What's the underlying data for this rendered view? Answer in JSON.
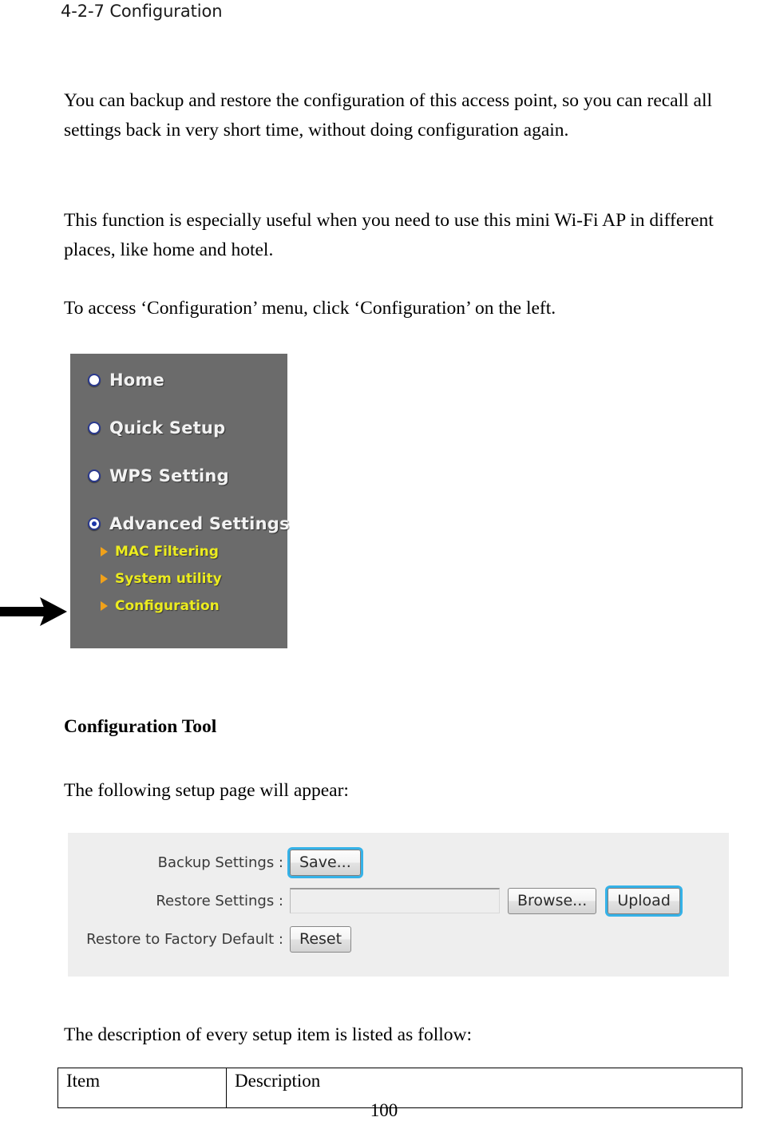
{
  "document": {
    "heading": "4-2-7 Configuration",
    "paragraph_1": "You can backup and restore the configuration of this access point, so you can recall all settings back in very short time, without doing configuration again.",
    "paragraph_2": "This function is especially useful when you need to use this mini Wi-Fi AP in different places, like home and hotel.",
    "paragraph_3": "To access ‘Configuration’ menu, click ‘Configuration’ on the left.",
    "section_heading": "Configuration Tool",
    "paragraph_4": "The following setup page will appear:",
    "paragraph_5": "The description of every setup item is listed as follow:",
    "page_number": "100"
  },
  "nav_screenshot": {
    "background_color": "#6b6b6b",
    "top_items": [
      {
        "label": "Home",
        "selected": false,
        "icon": "bullet-icon"
      },
      {
        "label": "Quick Setup",
        "selected": false,
        "icon": "bullet-icon"
      },
      {
        "label": "WPS Setting",
        "selected": false,
        "icon": "bullet-icon"
      },
      {
        "label": "Advanced Settings",
        "selected": true,
        "icon": "radio-selected-icon"
      }
    ],
    "sub_items": [
      {
        "label": "MAC Filtering",
        "icon": "triangle-right-icon"
      },
      {
        "label": "System utility",
        "icon": "triangle-right-icon"
      },
      {
        "label": "Configuration",
        "icon": "triangle-right-icon"
      }
    ],
    "label_color": "#f2f2f2",
    "sub_label_color": "#ecec1f",
    "sub_marker_color": "#f0a11a"
  },
  "annotation": {
    "arrow_icon": "arrow-right-icon",
    "arrow_color": "#000000",
    "points_to": "Configuration"
  },
  "config_panel": {
    "background_color": "#eeeeee",
    "rows": [
      {
        "label": "Backup Settings :",
        "button": "Save...",
        "button_focused": true
      },
      {
        "label": "Restore Settings :",
        "input_value": "",
        "input_placeholder": "",
        "browse_button": "Browse...",
        "upload_button": "Upload",
        "upload_focused": true
      },
      {
        "label": "Restore to Factory Default :",
        "button": "Reset",
        "button_focused": false
      }
    ],
    "focus_ring_color": "#35b2e8"
  },
  "description_table": {
    "headers": [
      "Item",
      "Description"
    ]
  }
}
